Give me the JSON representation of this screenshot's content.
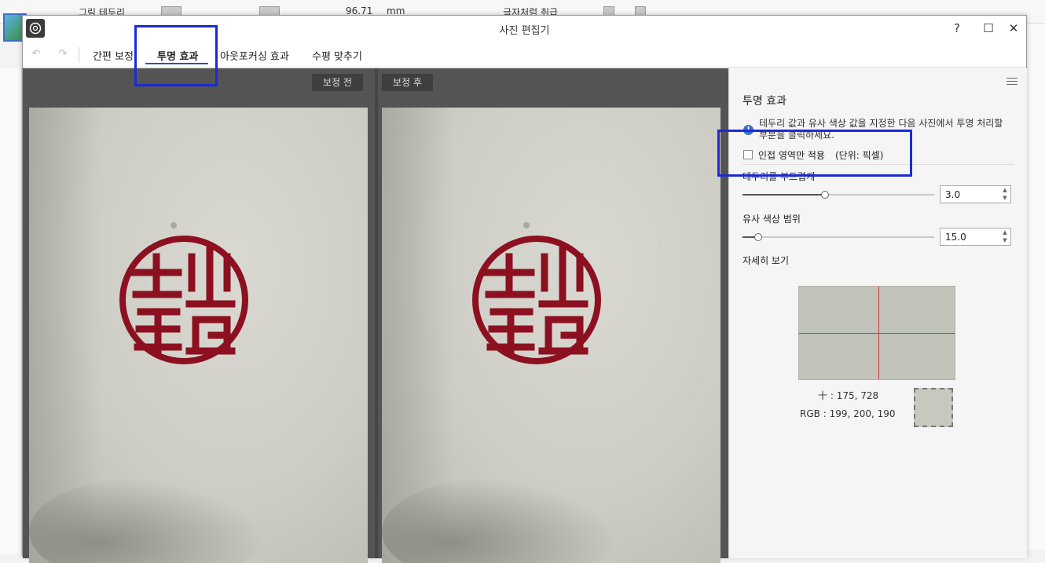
{
  "host": {
    "toolbar_text_1": "그림 테두리",
    "toolbar_value": "96.71",
    "toolbar_unit": "mm",
    "toolbar_text_2": "글자처럼 취급"
  },
  "window": {
    "title": "사진 편집기",
    "help_label": "?",
    "maximize_label": "☐",
    "close_label": "✕"
  },
  "tabs": [
    {
      "label": "간편 보정"
    },
    {
      "label": "투명 효과"
    },
    {
      "label": "아웃포커싱 효과"
    },
    {
      "label": "수평 맞추기"
    }
  ],
  "preview": {
    "before_label": "보정 전",
    "after_label": "보정 후"
  },
  "panel": {
    "title": "투명 효과",
    "info": "테두리 값과 유사 색상 값을 지정한 다음 사진에서 투명 처리할 부분을 클릭하세요.",
    "adjacent_label": "인접 영역만 적용",
    "unit_label": "(단위: 픽셀)",
    "smooth_label": "테두리를 부드럽게",
    "smooth_value": "3.0",
    "smooth_level": 0.43,
    "range_label": "유사 색상 범위",
    "range_value": "15.0",
    "range_level": 0.08,
    "detail_label": "자세히 보기",
    "coord_label": "175, 728",
    "rgb_prefix": "RGB",
    "rgb_label": "199, 200, 190"
  },
  "colors": {
    "accent": "#2a52be",
    "highlight": "#1a2bd6",
    "seal": "#8c1020"
  }
}
